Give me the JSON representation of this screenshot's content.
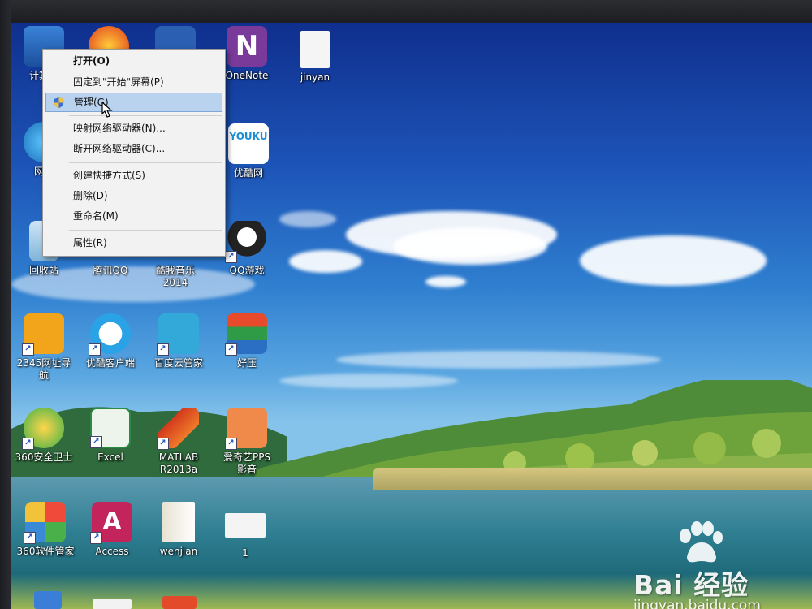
{
  "desktop_icons": [
    {
      "id": "computer",
      "label": "计算机"
    },
    {
      "id": "app-360-game",
      "label": ""
    },
    {
      "id": "word",
      "label": ""
    },
    {
      "id": "onenote",
      "label": "OneNote"
    },
    {
      "id": "jinyan",
      "label": "jinyan"
    },
    {
      "id": "network",
      "label": "网络"
    },
    {
      "id": "youku",
      "label": "优酷网"
    },
    {
      "id": "recycle-bin",
      "label": "回收站"
    },
    {
      "id": "tencent-qq",
      "label": "腾讯QQ"
    },
    {
      "id": "kuwo-music",
      "label": "酷我音乐\n2014"
    },
    {
      "id": "qq-game",
      "label": "QQ游戏"
    },
    {
      "id": "nav-2345",
      "label": "2345网址导\n航"
    },
    {
      "id": "youku-client",
      "label": "优酷客户端"
    },
    {
      "id": "baidu-cloud",
      "label": "百度云管家"
    },
    {
      "id": "haozip",
      "label": "好压"
    },
    {
      "id": "security-360",
      "label": "360安全卫士"
    },
    {
      "id": "excel",
      "label": "Excel"
    },
    {
      "id": "matlab",
      "label": "MATLAB\nR2013a"
    },
    {
      "id": "iqiyi-pps",
      "label": "爱奇艺PPS\n影音"
    },
    {
      "id": "software-360",
      "label": "360软件管家"
    },
    {
      "id": "access",
      "label": "Access"
    },
    {
      "id": "wenjian",
      "label": "wenjian"
    },
    {
      "id": "folder-1",
      "label": "1"
    }
  ],
  "context_menu": {
    "items": [
      {
        "label": "打开(O)",
        "bold": true
      },
      {
        "label": "固定到\"开始\"屏幕(P)"
      },
      {
        "label": "管理(G)",
        "highlighted": true,
        "icon": "uac-shield-icon"
      },
      {
        "label": "映射网络驱动器(N)..."
      },
      {
        "label": "断开网络驱动器(C)..."
      },
      {
        "label": "创建快捷方式(S)"
      },
      {
        "label": "删除(D)"
      },
      {
        "label": "重命名(M)"
      },
      {
        "label": "属性(R)"
      }
    ]
  },
  "watermark": {
    "brand": "Bai 经验",
    "url": "jingyan.baidu.com"
  },
  "colors": {
    "menu_bg": "#f2f2f2",
    "menu_highlight": "#b9d3ef",
    "sky_top": "#0f2f8e"
  }
}
